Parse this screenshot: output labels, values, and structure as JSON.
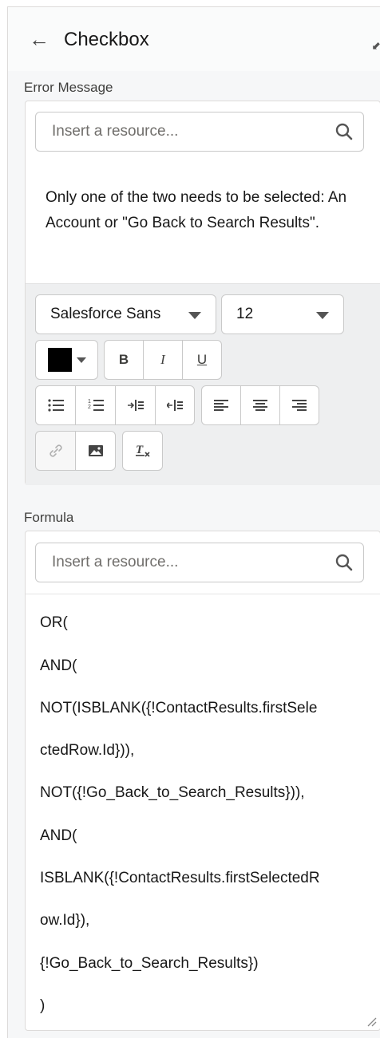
{
  "header": {
    "back_icon": "back-arrow-icon",
    "title": "Checkbox"
  },
  "error_message": {
    "label": "Error Message",
    "search_placeholder": "Insert a resource...",
    "text": "Only one of the two needs to be selected: An Account or \"Go Back to Search Results\".",
    "toolbar": {
      "font_family": "Salesforce Sans",
      "font_size": "12",
      "text_color": "#000000",
      "bold": "B",
      "italic": "I",
      "underline": "U"
    }
  },
  "formula": {
    "label": "Formula",
    "search_placeholder": "Insert a resource...",
    "lines": [
      "OR(",
      " AND(",
      "NOT(ISBLANK({!ContactResults.firstSele",
      "ctedRow.Id})),",
      "NOT({!Go_Back_to_Search_Results})),",
      "AND(",
      "ISBLANK({!ContactResults.firstSelectedR",
      "ow.Id}),",
      "{!Go_Back_to_Search_Results})",
      ")"
    ]
  }
}
